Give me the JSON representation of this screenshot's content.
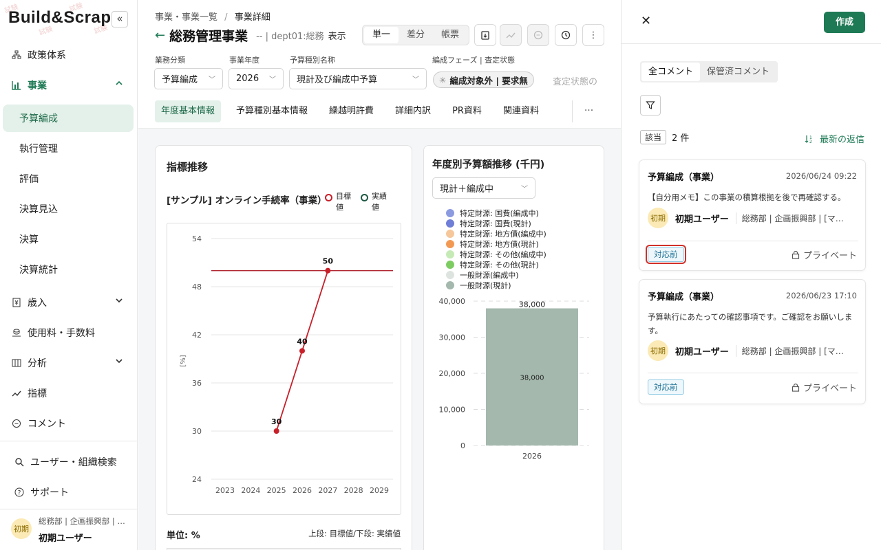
{
  "app": {
    "logo": "Build&Scrap",
    "collapse_label": "«",
    "stamp_text": "試験"
  },
  "sidebar": {
    "items": [
      {
        "label": "政策体系",
        "icon": "org-chart-icon"
      },
      {
        "label": "事業",
        "icon": "bar-chart-icon",
        "expanded": true
      },
      {
        "label": "歳入",
        "icon": "yen-doc-icon"
      },
      {
        "label": "使用料・手数料",
        "icon": "coins-icon"
      },
      {
        "label": "分析",
        "icon": "columns-icon"
      },
      {
        "label": "指標",
        "icon": "trend-icon"
      },
      {
        "label": "コメント",
        "icon": "chat-icon"
      }
    ],
    "sub_items": [
      "予算編成",
      "執行管理",
      "評価",
      "決算見込",
      "決算",
      "決算統計"
    ],
    "selected_sub": "予算編成",
    "bottom": [
      {
        "label": "ユーザー・組織検索",
        "icon": "search-icon"
      },
      {
        "label": "サポート",
        "icon": "help-icon"
      }
    ],
    "user": {
      "avatar": "初期",
      "org": "総務部 | 企画振興部 | …",
      "name": "初期ユーザー"
    }
  },
  "header": {
    "breadcrumb": {
      "parent": "事業・事業一覧",
      "sep": "/",
      "current": "事業詳細"
    },
    "back_icon": "←",
    "title": "総務管理事業",
    "subtitle": "-- | dept01:総務",
    "view_label": "表示",
    "view_modes": [
      "単一",
      "差分",
      "帳票"
    ],
    "view_selected": "単一",
    "more": "⋮"
  },
  "filters": [
    {
      "label": "業務分類",
      "value": "予算編成"
    },
    {
      "label": "事業年度",
      "value": "2026"
    },
    {
      "label": "予算種別名称",
      "value": "現計及び編成中予算"
    }
  ],
  "phase": {
    "label": "編成フェーズ | 査定状態",
    "value": "編成対象外 | 要求無",
    "truncated": "査定状態の",
    "spinner": "✳"
  },
  "tabs": [
    "年度基本情報",
    "予算種別基本情報",
    "繰越明許費",
    "詳細内訳",
    "PR資料",
    "関連資料"
  ],
  "tab_more": "···",
  "indicator": {
    "section_title": "指標推移",
    "chart_title": "[サンプル] オンライン手続率（事業）",
    "legend_target": "目標値",
    "legend_actual": "実績値",
    "unit_label": "単位: %",
    "note": "上段: 目標値/下段: 実績値"
  },
  "budget": {
    "section_title": "年度別予算額推移 (千円)",
    "select_value": "現計＋編成中"
  },
  "chart_data": [
    {
      "type": "line",
      "title": "[サンプル] オンライン手続率（事業）",
      "ylabel": "[%]",
      "xlabel": "",
      "x": [
        "2023",
        "2024",
        "2025",
        "2026",
        "2027",
        "2028",
        "2029"
      ],
      "ylim": [
        24,
        54
      ],
      "yticks": [
        "54",
        "48",
        "42",
        "36",
        "30",
        "24"
      ],
      "series": [
        {
          "name": "目標値",
          "type": "hline",
          "value": 50,
          "color": "#b02530"
        },
        {
          "name": "実績値",
          "values": [
            null,
            null,
            30,
            40,
            50,
            null,
            null
          ],
          "labels": [
            "",
            "",
            "30",
            "40",
            "50",
            "",
            ""
          ],
          "color": "#c8202a"
        }
      ],
      "legend": "top-right",
      "grid": true
    },
    {
      "type": "bar",
      "title": "年度別予算額推移 (千円)",
      "categories": [
        "2026"
      ],
      "ylim": [
        0,
        40000
      ],
      "yticks": [
        "40,000",
        "30,000",
        "20,000",
        "10,000",
        "0"
      ],
      "legend_entries": [
        {
          "name": "特定財源: 国費(編成中)",
          "color": "#8c9be0"
        },
        {
          "name": "特定財源: 国費(現計)",
          "color": "#6f7ed6"
        },
        {
          "name": "特定財源: 地方債(編成中)",
          "color": "#f6c79a"
        },
        {
          "name": "特定財源: 地方債(現計)",
          "color": "#f29a54"
        },
        {
          "name": "特定財源: その他(編成中)",
          "color": "#c6eab6"
        },
        {
          "name": "特定財源: その他(現計)",
          "color": "#7dcc62"
        },
        {
          "name": "一般財源(編成中)",
          "color": "#dde4e0"
        },
        {
          "name": "一般財源(現計)",
          "color": "#a4b8ad"
        }
      ],
      "series": [
        {
          "name": "一般財源(現計)",
          "values": [
            38000
          ]
        }
      ],
      "data_labels": [
        "38,000"
      ],
      "inner_labels": [
        "38,000"
      ],
      "legend": "top"
    }
  ],
  "comments": {
    "create_label": "作成",
    "close_icon": "✕",
    "tabs": [
      "全コメント",
      "保管済コメント"
    ],
    "selected_tab": "全コメント",
    "count_tag": "該当",
    "count_text": "2 件",
    "sort_label": "最新の返信",
    "sort_icon": "sort-icon",
    "items": [
      {
        "title": "予算編成（事業）",
        "date": "2026/06/24 09:22",
        "body": "【自分用メモ】この事業の積算根拠を後で再確認する。",
        "avatar": "初期",
        "user": "初期ユーザー",
        "org": "総務部 | 企画振興部 | [マニ…",
        "status": "対応前",
        "privacy": "プライベート"
      },
      {
        "title": "予算編成（事業）",
        "date": "2026/06/23 17:10",
        "body": "予算執行にあたっての確認事項です。ご確認をお願いします。",
        "avatar": "初期",
        "user": "初期ユーザー",
        "org": "総務部 | 企画振興部 | [マニ…",
        "status": "対応前",
        "privacy": "プライベート"
      }
    ]
  }
}
